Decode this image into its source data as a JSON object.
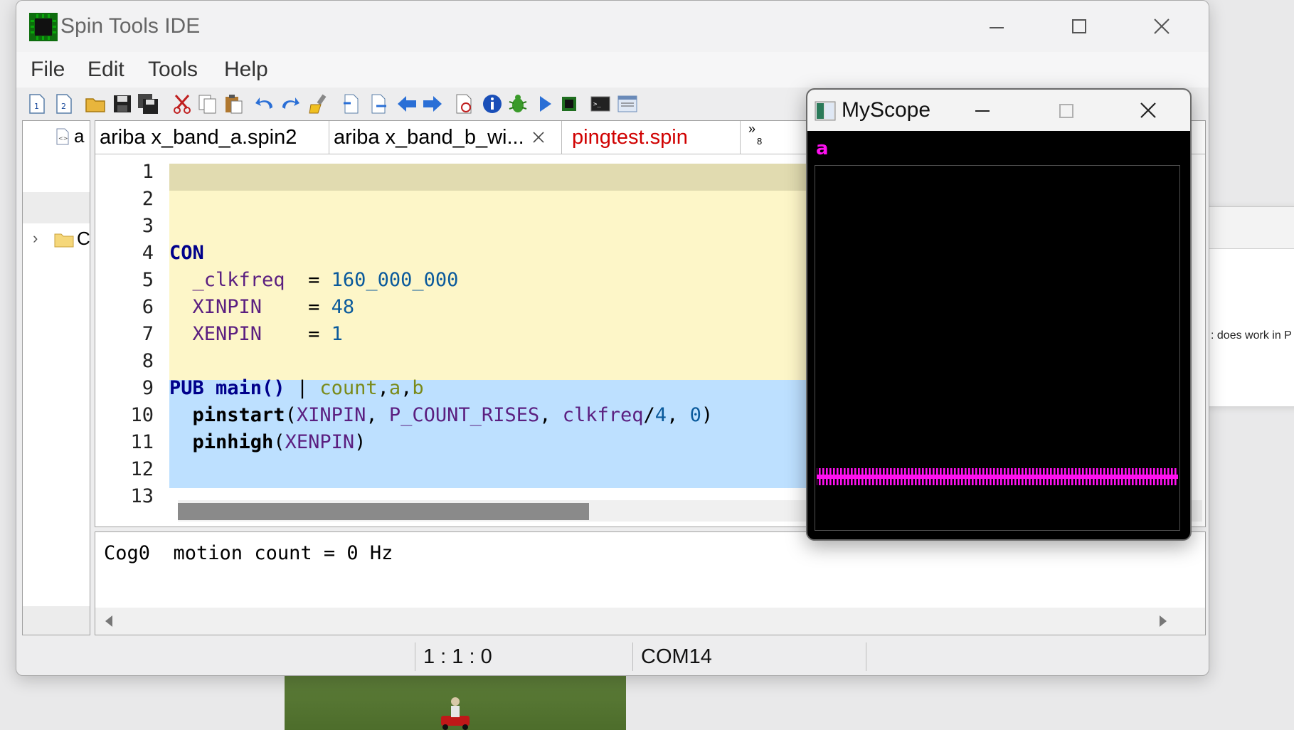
{
  "main_window": {
    "title": "Spin Tools IDE"
  },
  "menu": [
    "File",
    "Edit",
    "Tools",
    "Help"
  ],
  "toolbar_icons": [
    "new-spin1-icon",
    "new-spin2-icon",
    "open-icon",
    "save-icon",
    "save-all-icon",
    "cut-icon",
    "copy-icon",
    "paste-icon",
    "undo-icon",
    "redo-icon",
    "format-icon",
    "nav-prev-page-icon",
    "nav-next-page-icon",
    "back-icon",
    "forward-icon",
    "compile-icon",
    "info-icon",
    "debug-icon",
    "run-icon",
    "upload-icon",
    "terminal-icon",
    "console-icon"
  ],
  "left_pane": {
    "header_file_label": "a",
    "tree_folder_label": "C"
  },
  "tabs": [
    {
      "label": "ariba x_band_a.spin2",
      "active": false,
      "color": "#000000"
    },
    {
      "label": "ariba x_band_b_wi...",
      "active": true,
      "color": "#000000",
      "closable": true
    },
    {
      "label": "pingtest.spin",
      "active": false,
      "color": "#d00000"
    }
  ],
  "tabs_overflow": {
    "label": "»",
    "count": "8"
  },
  "editor": {
    "line_numbers": [
      "1",
      "2",
      "3",
      "4",
      "5",
      "6",
      "7",
      "8",
      "9",
      "10",
      "11",
      "12",
      "13"
    ],
    "code": {
      "l4_kw": "CON",
      "l5_name": "  _clkfreq",
      "l5_eq": "  = ",
      "l5_val": "160_000_000",
      "l6_name": "  XINPIN",
      "l6_eq": "    = ",
      "l6_val": "48",
      "l7_name": "  XENPIN",
      "l7_eq": "    = ",
      "l7_val": "1",
      "l9_kw": "PUB",
      "l9_sig": " main() ",
      "l9_bar": "| ",
      "l9_loc_count": "count",
      "l9_comma1": ",",
      "l9_loc_a": "a",
      "l9_comma2": ",",
      "l9_loc_b": "b",
      "l10_fn": "  pinstart",
      "l10_p1": "(",
      "l10_a1": "XINPIN",
      "l10_c1": ", ",
      "l10_a2": "P_COUNT_RISES",
      "l10_c2": ", ",
      "l10_a3": "clkfreq",
      "l10_div": "/",
      "l10_a3n": "4",
      "l10_c3": ", ",
      "l10_a4": "0",
      "l10_p2": ")",
      "l11_fn": "  pinhigh",
      "l11_p1": "(",
      "l11_a1": "XENPIN",
      "l11_p2": ")"
    }
  },
  "console": {
    "output": "Cog0  motion count = 0 Hz"
  },
  "status": {
    "cursor": "1 : 1 : 0",
    "port": "COM14"
  },
  "scope": {
    "title": "MyScope",
    "channel_label": "a",
    "trace_color": "#ff10f0"
  },
  "background": {
    "snippet": ": does work in P"
  },
  "colors": {
    "con_block_bg": "#fdf6c8",
    "con_header_bg": "#e1dbb0",
    "pub_block_bg": "#bde0ff",
    "keyword": "#00008b",
    "constant": "#5b1f80",
    "number": "#0a5a9c",
    "local": "#7a8a1a"
  }
}
